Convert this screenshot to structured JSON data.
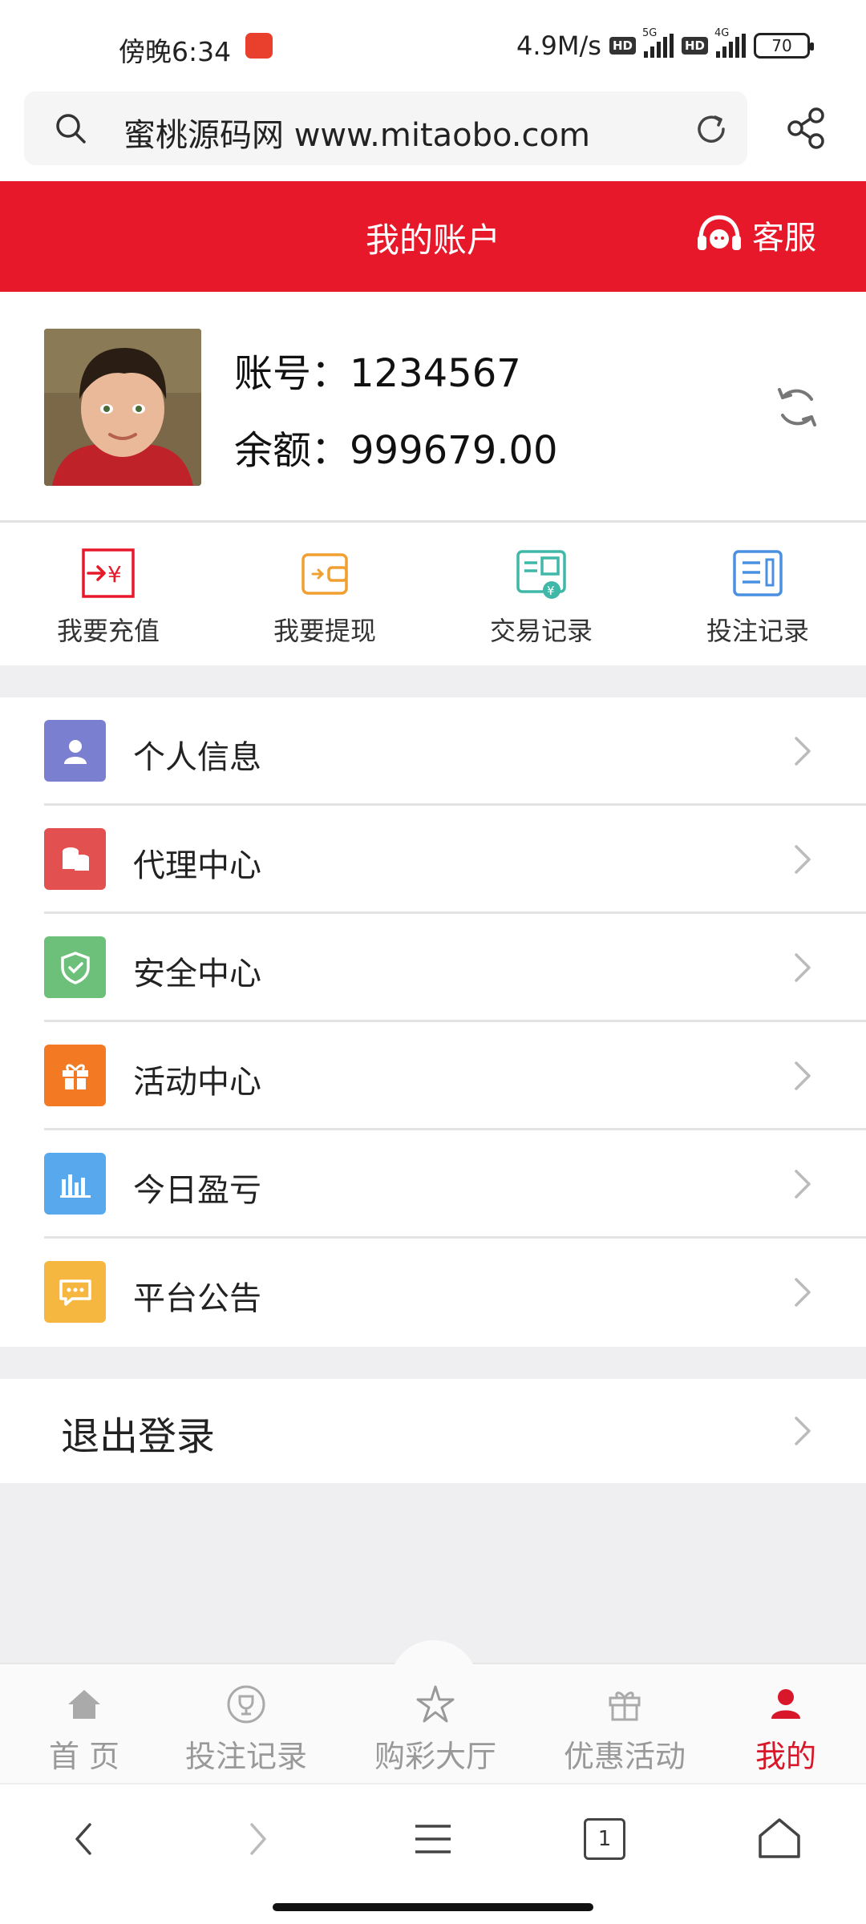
{
  "status_bar": {
    "time": "傍晚6:34",
    "speed": "4.9M/s",
    "hd1": "HD",
    "net1": "5G",
    "hd2": "HD",
    "net2": "4G",
    "battery": "70"
  },
  "browser": {
    "url_text": "蜜桃源码网 www.mitaobo.com",
    "icons": [
      "search-icon",
      "reload-icon",
      "share-icon"
    ]
  },
  "header": {
    "title": "我的账户",
    "service_label": "客服"
  },
  "profile": {
    "account_label": "账号：",
    "account_value": "1234567",
    "balance_label": "余额：",
    "balance_value": "999679.00"
  },
  "actions": [
    {
      "label": "我要充值",
      "icon": "deposit-icon",
      "color": "#e8182b"
    },
    {
      "label": "我要提现",
      "icon": "wallet-icon",
      "color": "#f0a030"
    },
    {
      "label": "交易记录",
      "icon": "transaction-icon",
      "color": "#3fb8a8"
    },
    {
      "label": "投注记录",
      "icon": "bet-record-icon",
      "color": "#4a90e2"
    }
  ],
  "menu": [
    {
      "label": "个人信息",
      "icon": "person-icon",
      "color": "#7b7fd0"
    },
    {
      "label": "代理中心",
      "icon": "coins-icon",
      "color": "#e25050"
    },
    {
      "label": "安全中心",
      "icon": "shield-icon",
      "color": "#6cc07a"
    },
    {
      "label": "活动中心",
      "icon": "gift-icon",
      "color": "#f37a22"
    },
    {
      "label": "今日盈亏",
      "icon": "bar-chart-icon",
      "color": "#58a8ee"
    },
    {
      "label": "平台公告",
      "icon": "message-icon",
      "color": "#f6b740"
    }
  ],
  "logout_label": "退出登录",
  "bottom_nav": [
    {
      "label": "首 页",
      "icon": "home-icon",
      "active": false
    },
    {
      "label": "投注记录",
      "icon": "trophy-icon",
      "active": false
    },
    {
      "label": "购彩大厅",
      "icon": "star-icon",
      "active": false
    },
    {
      "label": "优惠活动",
      "icon": "gift-icon",
      "active": false
    },
    {
      "label": "我的",
      "icon": "user-icon",
      "active": true
    }
  ],
  "browser_toolbar": {
    "tab_count": "1",
    "icons": [
      "back-icon",
      "forward-icon",
      "menu-icon",
      "tabs-icon",
      "home-icon"
    ]
  },
  "colors": {
    "brand_red": "#e8182b",
    "page_gray": "#efeff1"
  }
}
